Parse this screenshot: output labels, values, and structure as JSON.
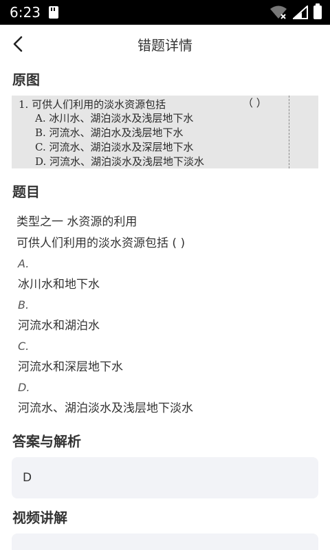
{
  "status": {
    "time": "6:23"
  },
  "header": {
    "title": "错题详情"
  },
  "sections": {
    "original": "原图",
    "question": "题目",
    "answer": "答案与解析",
    "video": "视频讲解"
  },
  "scan": {
    "lines": [
      "1.  可供人们利用的淡水资源包括",
      "（      ）",
      "A.  冰川水、湖泊淡水及浅层地下水",
      "B.  河流水、湖泊水及浅层地下水",
      "C.  河流水、湖泊淡水及深层地下水",
      "D.  河流水、湖泊淡水及浅层地下淡水"
    ]
  },
  "question": {
    "type": "类型之一   水资源的利用",
    "stem": "可供人们利用的淡水资源包括      ( )",
    "options": [
      {
        "label": "A.",
        "text": "冰川水和地下水"
      },
      {
        "label": "B.",
        "text": "河流水和湖泊水"
      },
      {
        "label": "C.",
        "text": "河流水和深层地下水"
      },
      {
        "label": "D.",
        "text": "河流水、湖泊淡水及浅层地下淡水"
      }
    ]
  },
  "answer": {
    "value": "D"
  }
}
